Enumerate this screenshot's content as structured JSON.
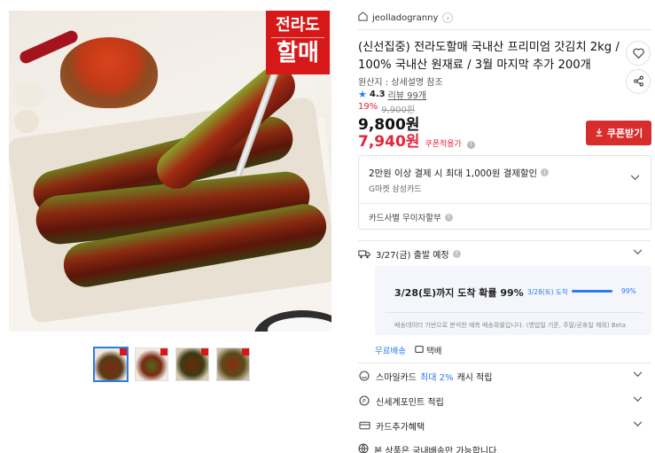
{
  "gallery": {
    "main_image": {
      "alt": "pickled mustard greens kimchi on plate",
      "stamp_line1": "전라도",
      "stamp_line2": "할매"
    },
    "thumbnails": [
      {
        "name": "thumb-1",
        "active": true
      },
      {
        "name": "thumb-2",
        "active": false
      },
      {
        "name": "thumb-3",
        "active": false
      },
      {
        "name": "thumb-4",
        "active": false
      }
    ]
  },
  "seller": {
    "name": "jeolladogranny"
  },
  "product": {
    "title": "(신선집중) 전라도할매 국내산 프리미엄 갓김치 2kg / 100% 국내산 원재료 / 3월 마지막 추가 200개",
    "origin": "원산지 : 상세설명 참조",
    "rating": "4.3",
    "reviews": "리뷰 99개",
    "discount_pct": "19%",
    "original_price": "9,900원",
    "price": "9,800원",
    "coupon_price": "7,940원",
    "coupon_price_label": "쿠폰적용가",
    "coupon_button": "쿠폰받기"
  },
  "card_promo": {
    "headline": "2만원 이상 결제 시 최대 1,000원 결제할인",
    "card": "G마켓 삼성카드",
    "installment": "카드사별 무이자할부"
  },
  "delivery": {
    "ship_date": "3/27(금) 출발 예정",
    "probability_text": "3/28(토)까지 도착 확률 99%",
    "arrival_date": "3/28(토) 도착",
    "arrival_pct": "99%",
    "arrival_fraction": 0.99,
    "note": "배송데이터 기반으로 분석한 예측 배송확률입니다. (영업일 기준, 주말/공휴일 제외) Beta",
    "free_shipping": "무료배송",
    "courier": "택배"
  },
  "benefits": {
    "smilecard_prefix": "스마일카드",
    "smilecard_highlight": "최대 2%",
    "smilecard_suffix": "캐시 적립",
    "shinsegae": "신세계포인트 적립",
    "card_extra": "카드추가혜택",
    "domestic": "본 상품은 국내배송만 가능합니다."
  },
  "colors": {
    "accent_red": "#d82d2d",
    "accent_blue": "#2d7bf0"
  }
}
